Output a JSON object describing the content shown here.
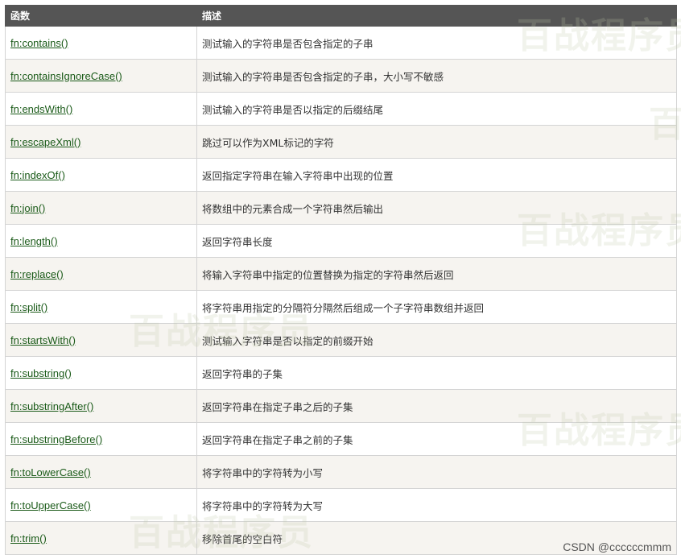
{
  "table": {
    "headers": [
      "函数",
      "描述"
    ],
    "rows": [
      {
        "fn": "fn:contains()",
        "desc": "测试输入的字符串是否包含指定的子串"
      },
      {
        "fn": "fn:containsIgnoreCase()",
        "desc": "测试输入的字符串是否包含指定的子串，大小写不敏感"
      },
      {
        "fn": "fn:endsWith()",
        "desc": "测试输入的字符串是否以指定的后缀结尾"
      },
      {
        "fn": "fn:escapeXml()",
        "desc": "跳过可以作为XML标记的字符"
      },
      {
        "fn": "fn:indexOf()",
        "desc": "返回指定字符串在输入字符串中出现的位置"
      },
      {
        "fn": "fn:join()",
        "desc": "将数组中的元素合成一个字符串然后输出"
      },
      {
        "fn": "fn:length()",
        "desc": "返回字符串长度"
      },
      {
        "fn": "fn:replace()",
        "desc": "将输入字符串中指定的位置替换为指定的字符串然后返回"
      },
      {
        "fn": "fn:split()",
        "desc": "将字符串用指定的分隔符分隔然后组成一个子字符串数组并返回"
      },
      {
        "fn": "fn:startsWith()",
        "desc": "测试输入字符串是否以指定的前缀开始"
      },
      {
        "fn": "fn:substring()",
        "desc": "返回字符串的子集"
      },
      {
        "fn": "fn:substringAfter()",
        "desc": "返回字符串在指定子串之后的子集"
      },
      {
        "fn": "fn:substringBefore()",
        "desc": "返回字符串在指定子串之前的子集"
      },
      {
        "fn": "fn:toLowerCase()",
        "desc": "将字符串中的字符转为小写"
      },
      {
        "fn": "fn:toUpperCase()",
        "desc": "将字符串中的字符转为大写"
      },
      {
        "fn": "fn:trim()",
        "desc": "移除首尾的空白符"
      }
    ]
  },
  "watermark_text": "百战程序员",
  "credit": "CSDN @ccccccmmm",
  "colors": {
    "header_bg": "#555555",
    "header_text": "#ffffff",
    "link": "#1a5a18",
    "alt_row": "#f6f4f0",
    "border": "#d4d4d4"
  }
}
